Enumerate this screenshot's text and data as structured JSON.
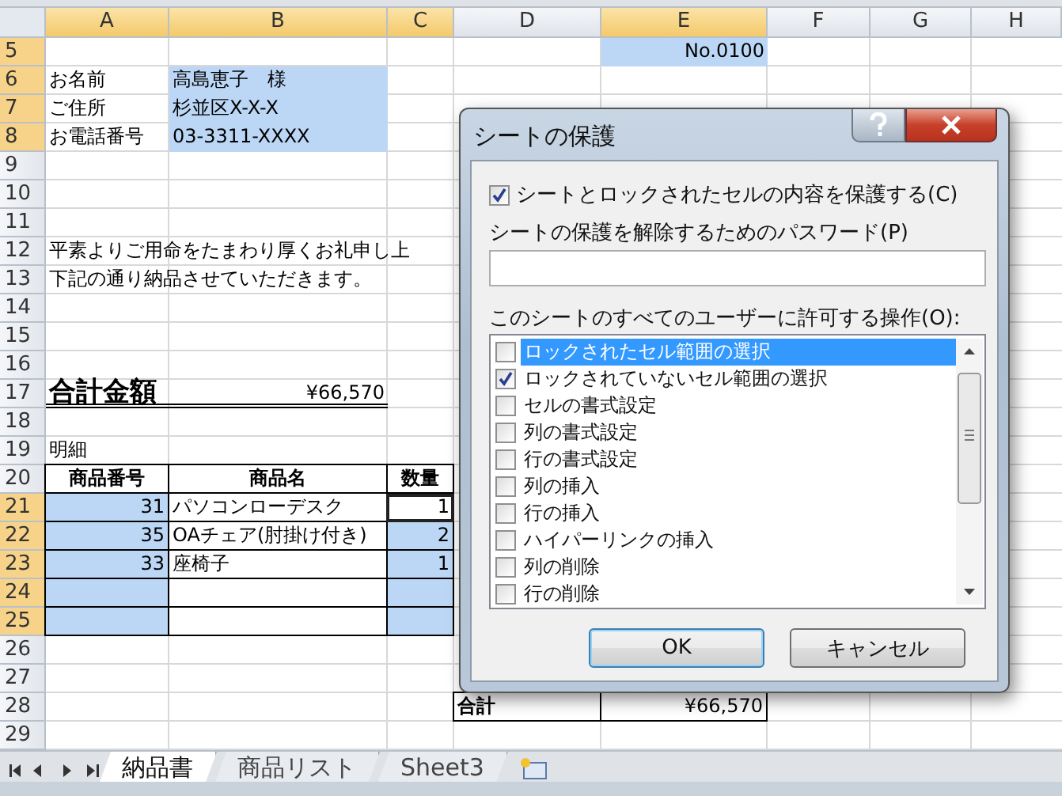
{
  "columns": [
    {
      "label": "A",
      "selected": true
    },
    {
      "label": "B",
      "selected": true
    },
    {
      "label": "C",
      "selected": true
    },
    {
      "label": "D",
      "selected": false
    },
    {
      "label": "E",
      "selected": true
    },
    {
      "label": "F",
      "selected": false
    },
    {
      "label": "G",
      "selected": false
    },
    {
      "label": "H",
      "selected": false
    }
  ],
  "rows": [
    {
      "number": "5",
      "selected": true,
      "cells": {
        "E": {
          "text": "No.0100",
          "kind": "number",
          "selected": true,
          "active": false
        }
      }
    },
    {
      "number": "6",
      "selected": true,
      "cells": {
        "A": {
          "text": "お名前",
          "kind": "text",
          "selected": false,
          "active": false
        },
        "B": {
          "text": "高島恵子　様",
          "kind": "text",
          "selected": true,
          "active": false
        }
      }
    },
    {
      "number": "7",
      "selected": true,
      "cells": {
        "A": {
          "text": "ご住所",
          "kind": "text",
          "selected": false,
          "active": false
        },
        "B": {
          "text": "杉並区X-X-X",
          "kind": "text",
          "selected": true,
          "active": false
        }
      }
    },
    {
      "number": "8",
      "selected": true,
      "cells": {
        "A": {
          "text": "お電話番号",
          "kind": "text",
          "selected": false,
          "active": false
        },
        "B": {
          "text": "03-3311-XXXX",
          "kind": "text",
          "selected": true,
          "active": false
        }
      }
    },
    {
      "number": "9",
      "selected": false,
      "cells": {}
    },
    {
      "number": "10",
      "selected": false,
      "cells": {}
    },
    {
      "number": "11",
      "selected": false,
      "cells": {}
    },
    {
      "number": "12",
      "selected": false,
      "cells": {
        "A": {
          "text": "平素よりご用命をたまわり厚くお礼申し上",
          "kind": "text",
          "selected": false,
          "active": false
        }
      }
    },
    {
      "number": "13",
      "selected": false,
      "cells": {
        "A": {
          "text": "下記の通り納品させていただきます。",
          "kind": "text",
          "selected": false,
          "active": false
        }
      }
    },
    {
      "number": "14",
      "selected": false,
      "cells": {}
    },
    {
      "number": "15",
      "selected": false,
      "cells": {}
    },
    {
      "number": "16",
      "selected": false,
      "cells": {}
    },
    {
      "number": "17",
      "selected": false,
      "cells": {
        "A": {
          "text": "合計金額",
          "kind": "total-label",
          "selected": false,
          "active": false
        },
        "B": {
          "text": "¥66,570",
          "kind": "total-amount",
          "selected": false,
          "active": false
        }
      }
    },
    {
      "number": "18",
      "selected": false,
      "cells": {}
    },
    {
      "number": "19",
      "selected": false,
      "cells": {
        "A": {
          "text": "明細",
          "kind": "text",
          "selected": false,
          "active": false
        }
      }
    },
    {
      "number": "20",
      "selected": false,
      "cells": {
        "A": {
          "text": "商品番号",
          "kind": "table-header",
          "selected": false,
          "active": false
        },
        "B": {
          "text": "商品名",
          "kind": "table-header",
          "selected": false,
          "active": false
        },
        "C": {
          "text": "数量",
          "kind": "table-header",
          "selected": false,
          "active": false
        }
      }
    },
    {
      "number": "21",
      "selected": true,
      "cells": {
        "A": {
          "text": "31",
          "kind": "table-number",
          "selected": true,
          "active": false
        },
        "B": {
          "text": "パソコンローデスク",
          "kind": "table-text",
          "selected": false,
          "active": false
        },
        "C": {
          "text": "1",
          "kind": "table-number",
          "selected": false,
          "active": true
        }
      }
    },
    {
      "number": "22",
      "selected": true,
      "cells": {
        "A": {
          "text": "35",
          "kind": "table-number",
          "selected": true,
          "active": false
        },
        "B": {
          "text": "OAチェア(肘掛け付き)",
          "kind": "table-text",
          "selected": false,
          "active": false
        },
        "C": {
          "text": "2",
          "kind": "table-number",
          "selected": true,
          "active": false
        }
      }
    },
    {
      "number": "23",
      "selected": true,
      "cells": {
        "A": {
          "text": "33",
          "kind": "table-number",
          "selected": true,
          "active": false
        },
        "B": {
          "text": "座椅子",
          "kind": "table-text",
          "selected": false,
          "active": false
        },
        "C": {
          "text": "1",
          "kind": "table-number",
          "selected": true,
          "active": false
        }
      }
    },
    {
      "number": "24",
      "selected": true,
      "cells": {
        "A": {
          "kind": "table-number",
          "selected": true,
          "active": false
        },
        "B": {
          "kind": "table-text"
        },
        "C": {
          "kind": "table-number",
          "selected": true,
          "active": false
        }
      }
    },
    {
      "number": "25",
      "selected": true,
      "cells": {
        "A": {
          "kind": "table-number",
          "selected": true,
          "active": false
        },
        "B": {
          "kind": "table-text"
        },
        "C": {
          "kind": "table-number",
          "selected": true,
          "active": false
        }
      }
    },
    {
      "number": "26",
      "selected": false,
      "cells": {}
    },
    {
      "number": "27",
      "selected": false,
      "cells": {}
    },
    {
      "number": "28",
      "selected": false,
      "cells": {
        "D": {
          "text": "合計",
          "kind": "sum-label",
          "selected": false,
          "active": false
        },
        "E": {
          "text": "¥66,570",
          "kind": "sum-amount",
          "selected": false,
          "active": false
        }
      }
    },
    {
      "number": "29",
      "selected": false,
      "cells": {}
    }
  ],
  "sheet_tabs": [
    {
      "label": "納品書",
      "selected": true
    },
    {
      "label": "商品リスト",
      "selected": false
    },
    {
      "label": "Sheet3",
      "selected": false
    }
  ],
  "dialog": {
    "title": "シートの保護",
    "protect_checkbox": {
      "label": "シートとロックされたセルの内容を保護する(C)",
      "checked": true
    },
    "password_label": "シートの保護を解除するためのパスワード(P)",
    "permissions_label": "このシートのすべてのユーザーに許可する操作(O):",
    "permissions": [
      {
        "label": "ロックされたセル範囲の選択",
        "checked": false,
        "selected": true
      },
      {
        "label": "ロックされていないセル範囲の選択",
        "checked": true,
        "selected": false
      },
      {
        "label": "セルの書式設定",
        "checked": false,
        "selected": false
      },
      {
        "label": "列の書式設定",
        "checked": false,
        "selected": false
      },
      {
        "label": "行の書式設定",
        "checked": false,
        "selected": false
      },
      {
        "label": "列の挿入",
        "checked": false,
        "selected": false
      },
      {
        "label": "行の挿入",
        "checked": false,
        "selected": false
      },
      {
        "label": "ハイパーリンクの挿入",
        "checked": false,
        "selected": false
      },
      {
        "label": "列の削除",
        "checked": false,
        "selected": false
      },
      {
        "label": "行の削除",
        "checked": false,
        "selected": false
      }
    ],
    "buttons": [
      {
        "label": "OK",
        "kind": "default"
      },
      {
        "label": "キャンセル",
        "kind": "normal"
      }
    ]
  }
}
